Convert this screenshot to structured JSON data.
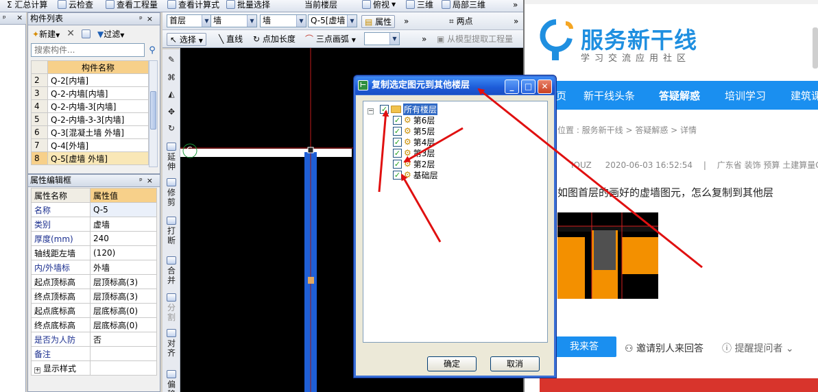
{
  "top_toolbar": {
    "items": [
      {
        "label": "Σ 汇总计算"
      },
      {
        "label": "云检查"
      },
      {
        "label": "查看工程量"
      },
      {
        "label": "查看计算式"
      },
      {
        "label": "批量选择"
      },
      {
        "label": "当前楼层"
      },
      {
        "label": "俯视"
      },
      {
        "label": "三维"
      },
      {
        "label": "局部三维"
      }
    ]
  },
  "component_list": {
    "title": "构件列表",
    "new_label": "新建",
    "filter_label": "过滤",
    "search_placeholder": "搜索构件...",
    "column_header": "构件名称",
    "rows": [
      {
        "num": "2",
        "name": "Q-2[内墙]"
      },
      {
        "num": "3",
        "name": "Q-2-内墙[内墙]"
      },
      {
        "num": "4",
        "name": "Q-2-内墙-3[内墙]"
      },
      {
        "num": "5",
        "name": "Q-2-内墙-3-3[内墙]"
      },
      {
        "num": "6",
        "name": "Q-3[混凝土墙 外墙]"
      },
      {
        "num": "7",
        "name": "Q-4[外墙]"
      },
      {
        "num": "8",
        "name": "Q-5[虚墙 外墙]"
      }
    ],
    "selected_num": "8"
  },
  "property_editor": {
    "title": "属性编辑框",
    "col_name": "属性名称",
    "col_value": "属性值",
    "rows": [
      {
        "k": "名称",
        "v": "Q-5"
      },
      {
        "k": "类别",
        "v": "虚墙"
      },
      {
        "k": "厚度(mm)",
        "v": "240"
      },
      {
        "k": "轴线距左墙",
        "v": "(120)"
      },
      {
        "k": "内/外墙标",
        "v": "外墙"
      },
      {
        "k": "起点顶标高",
        "v": "层顶标高(3)"
      },
      {
        "k": "终点顶标高",
        "v": "层顶标高(3)"
      },
      {
        "k": "起点底标高",
        "v": "层底标高(0)"
      },
      {
        "k": "终点底标高",
        "v": "层底标高(0)"
      },
      {
        "k": "是否为人防",
        "v": "否"
      },
      {
        "k": "备注",
        "v": ""
      },
      {
        "k": "显示样式",
        "v": ""
      }
    ]
  },
  "draw_toolbar": {
    "floor": "首层",
    "type1": "墙",
    "type2": "墙",
    "element": "Q-5[虚墙",
    "property_btn": "属性",
    "two_points": "两点",
    "select": "选择",
    "line": "直线",
    "point_length": "点加长度",
    "three_point_arc": "三点画弧",
    "extract": "从模型提取工程量"
  },
  "side_tools": [
    {
      "label": "延伸"
    },
    {
      "label": "修剪"
    },
    {
      "label": "打断"
    },
    {
      "label": "合并"
    },
    {
      "label": "分割"
    },
    {
      "label": "对齐"
    },
    {
      "label": "偏移"
    }
  ],
  "canvas": {
    "axis_label": "C"
  },
  "dialog": {
    "title": "复制选定图元到其他楼层",
    "tree_root": "所有楼层",
    "floors": [
      "第6层",
      "第5层",
      "第4层",
      "第3层",
      "第2层",
      "基础层"
    ],
    "ok": "确定",
    "cancel": "取消"
  },
  "website": {
    "brand": "服务新干线",
    "tagline": "学习交流应用社区",
    "nav": [
      "页",
      "新干线头条",
      "答疑解惑",
      "培训学习",
      "建筑课"
    ],
    "active_nav": "答疑解惑",
    "breadcrumb": "位置 : 服务新干线 > 答疑解惑 > 详情",
    "user": "IOUZ",
    "time": "2020-06-03 16:52:54",
    "separator": "|",
    "tags": "广东省  装饰 预算 土建算量GC",
    "question": "如图首层的画好的虚墙图元，怎么复制到其他层",
    "answer_btn": "我来答",
    "invite": "邀请别人来回答",
    "remind": "提醒提问者"
  },
  "colors": {
    "accent_blue": "#1a8ff0",
    "header_orange": "#f7d08a",
    "annotation_red": "#e01010",
    "wall_blue": "#1f5fd6"
  }
}
